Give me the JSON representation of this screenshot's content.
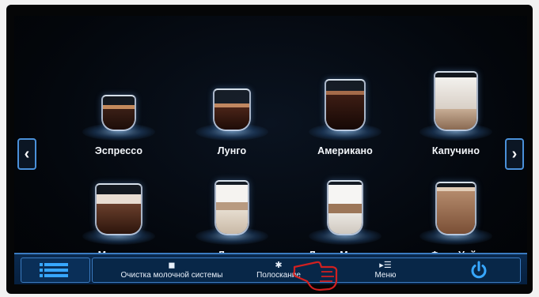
{
  "drinks": [
    {
      "name": "Эспрессо"
    },
    {
      "name": "Лунго"
    },
    {
      "name": "Американо"
    },
    {
      "name": "Капучино"
    },
    {
      "name": "Макиато"
    },
    {
      "name": "Латте"
    },
    {
      "name": "Латте Макиато"
    },
    {
      "name": "Флэт Уайт"
    }
  ],
  "nav": {
    "prev": "‹",
    "next": "›"
  },
  "bottom_bar": {
    "list_icon": "list-icon",
    "milk_cleaning": "Очистка молочной системы",
    "rinse": "Полоскание",
    "menu": "Меню",
    "power_icon": "power-icon"
  },
  "colors": {
    "accent": "#37a7ff",
    "bar_border": "#3b7cc2",
    "bar_bg": "#082748",
    "screen_bg": "#03060b"
  }
}
